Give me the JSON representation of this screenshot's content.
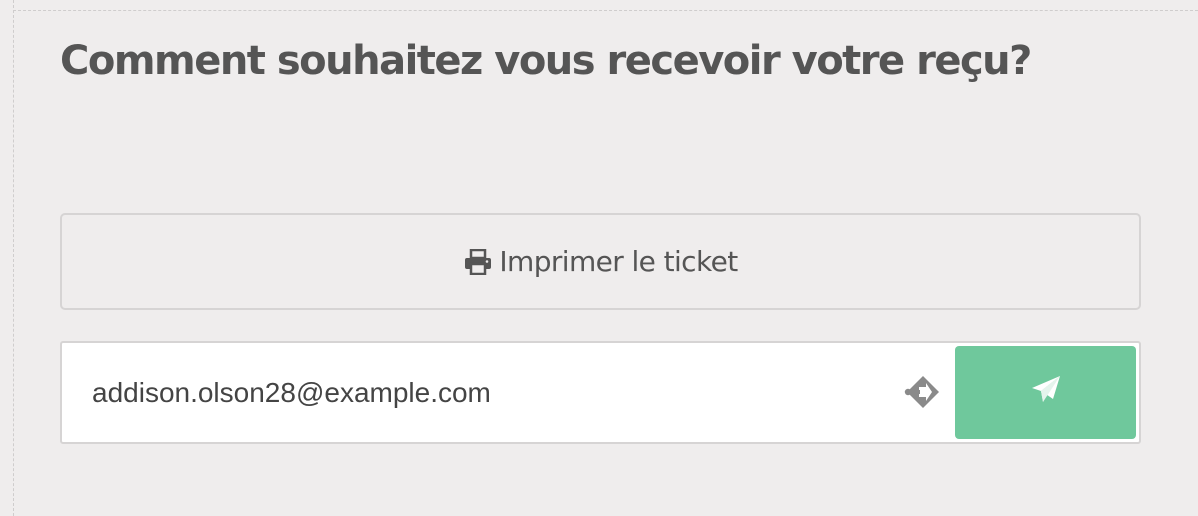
{
  "receipt": {
    "title": "Comment souhaitez vous recevoir votre reçu?",
    "print_button": {
      "label": "Imprimer le ticket",
      "icon": "printer-icon"
    },
    "email": {
      "value": "addison.olson28@example.com",
      "autofill_icon": "autofill-key-icon",
      "send_icon": "paper-plane-icon"
    }
  },
  "colors": {
    "background": "#efeded",
    "text": "#555555",
    "send_button": "#6fc89c",
    "border": "#d6d4d4"
  }
}
